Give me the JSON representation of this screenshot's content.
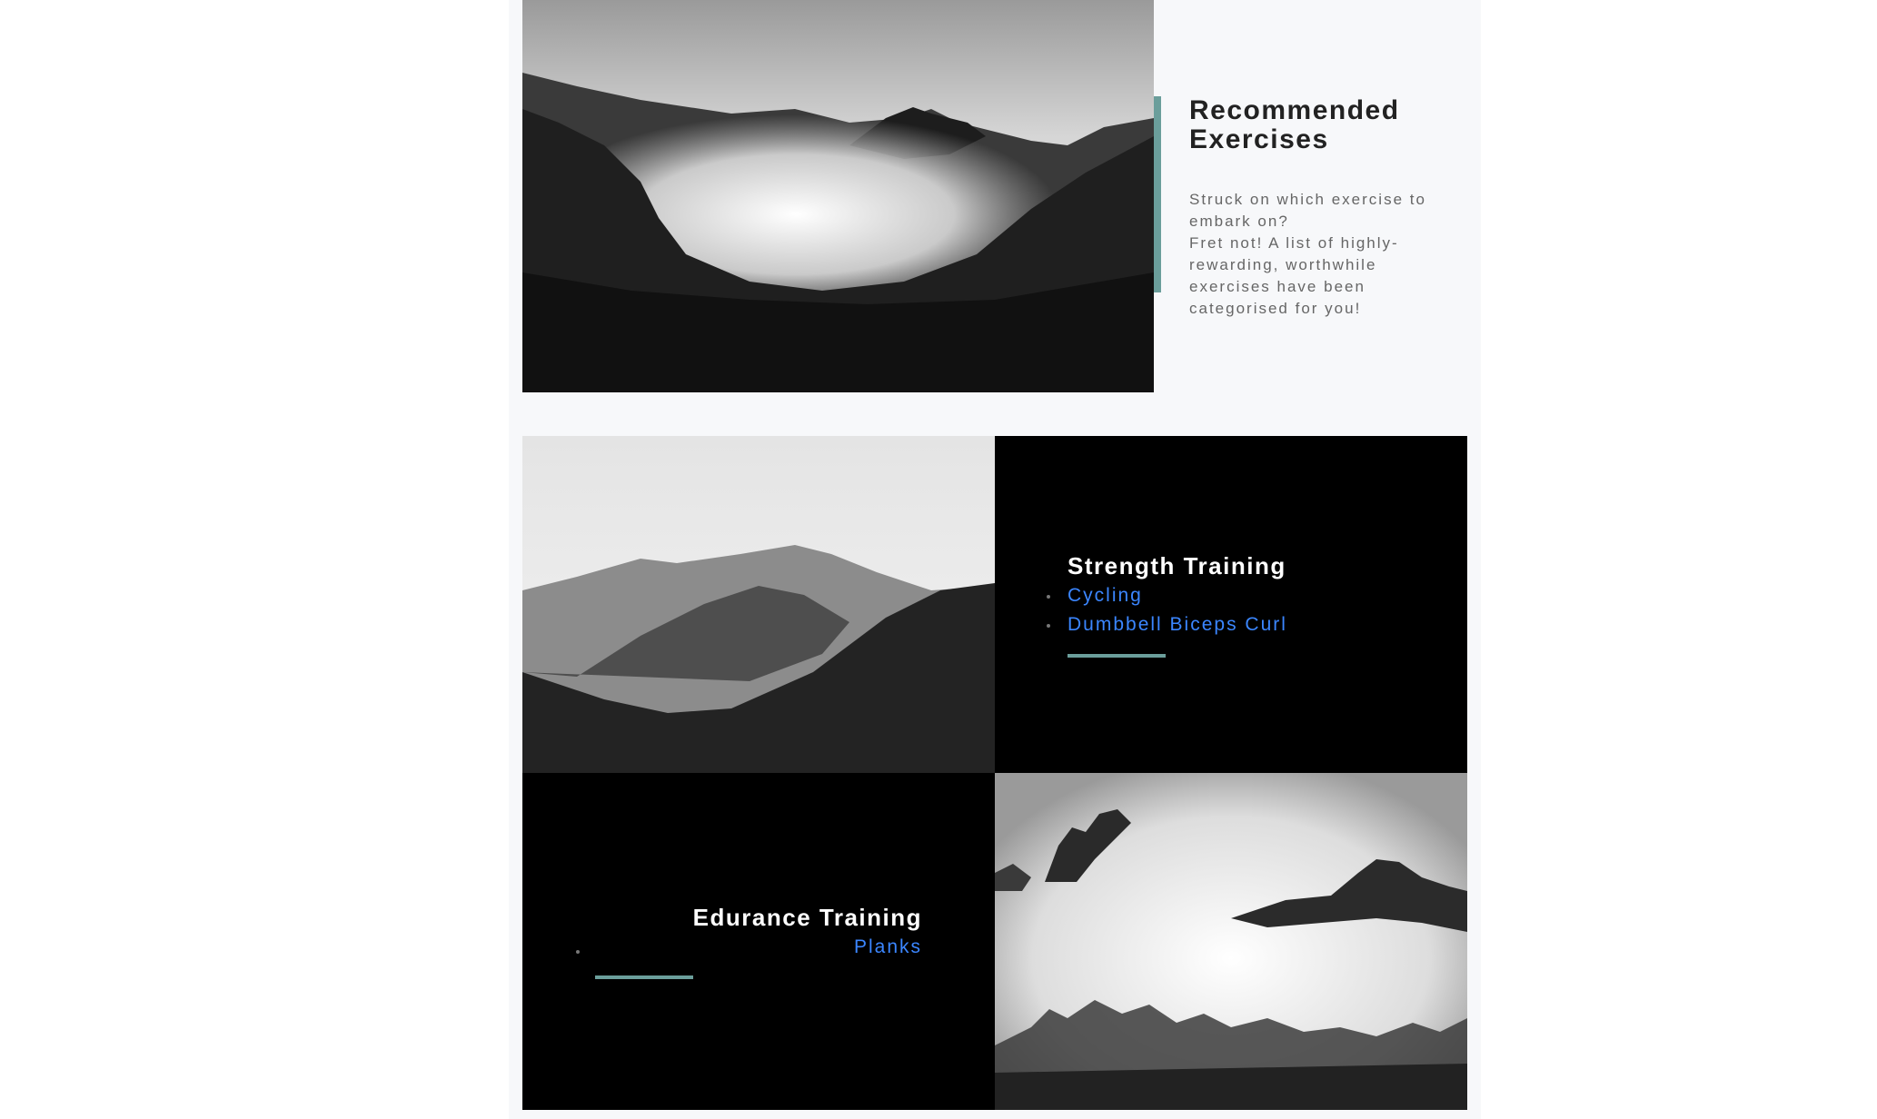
{
  "intro": {
    "title": "Recommended Exercises",
    "lines": [
      "Struck on which exercise to embark on?",
      "Fret not! A list of highly-rewarding, worthwhile exercises have been categorised for you!"
    ]
  },
  "images": {
    "hero": "misty-mountain-valley-photo",
    "tile_top_left": "layered-mountain-ridges-photo",
    "tile_bottom_right": "foggy-mountain-peaks-photo"
  },
  "cards": {
    "strength": {
      "title": "Strength Training",
      "items": [
        "Cycling",
        "Dumbbell Biceps Curl"
      ]
    },
    "endurance": {
      "title": "Edurance Training",
      "items": [
        "Planks"
      ]
    }
  },
  "colors": {
    "accent": "#6b9e9b",
    "link": "#3b86ff",
    "card_bg": "#000000",
    "page_bg": "#f7f8fa"
  }
}
